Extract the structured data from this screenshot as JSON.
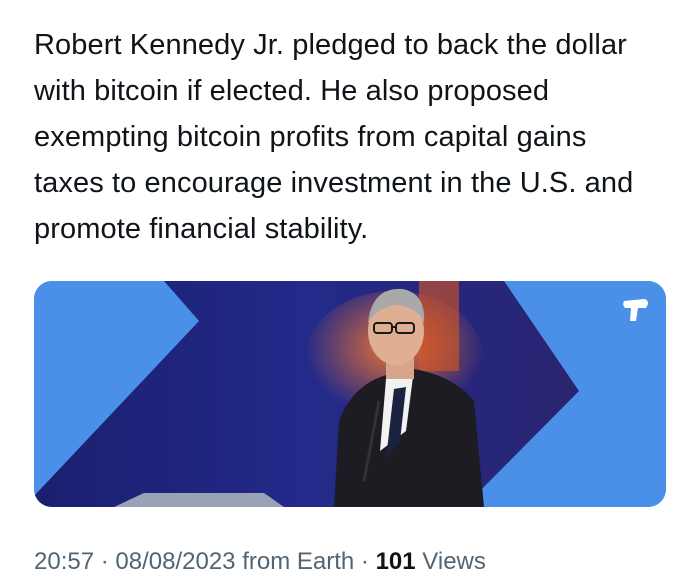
{
  "tweet": {
    "text_lines": [
      "Robert Kennedy Jr. pledged to back the dollar",
      "with bitcoin if elected. He also proposed",
      "exempting bitcoin profits from capital gains",
      "taxes to encourage investment in the U.S. and",
      "promote financial stability."
    ]
  },
  "media": {
    "background_color": "#4a90e8",
    "brand_badge_icon": "publisher-logo-icon"
  },
  "meta": {
    "time": "20:57",
    "separator": "·",
    "date": "08/08/2023",
    "source": "from Earth",
    "views_count": "101",
    "views_label": "Views"
  }
}
